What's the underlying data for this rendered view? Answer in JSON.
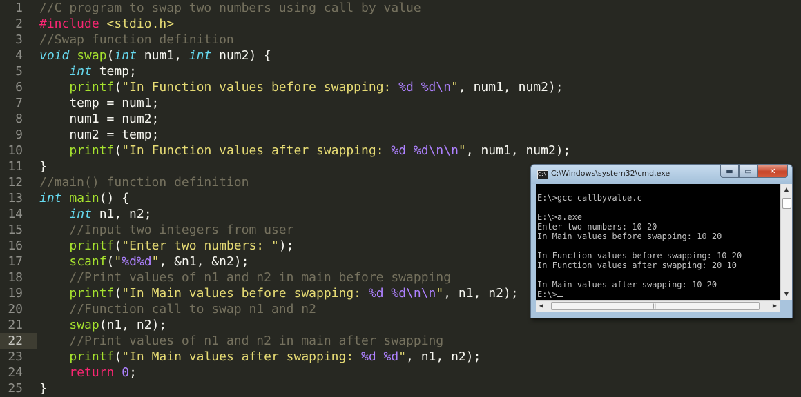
{
  "editor": {
    "active_line": 22,
    "lines": [
      {
        "n": "1",
        "tokens": [
          {
            "t": "//C program to swap two numbers using call by value",
            "c": "comment"
          }
        ]
      },
      {
        "n": "2",
        "tokens": [
          {
            "t": "#include",
            "c": "kw"
          },
          {
            "t": " ",
            "c": "plain"
          },
          {
            "t": "<stdio.h>",
            "c": "str"
          }
        ]
      },
      {
        "n": "3",
        "tokens": [
          {
            "t": "//Swap function definition",
            "c": "comment"
          }
        ]
      },
      {
        "n": "4",
        "tokens": [
          {
            "t": "void",
            "c": "type"
          },
          {
            "t": " ",
            "c": "plain"
          },
          {
            "t": "swap",
            "c": "fn"
          },
          {
            "t": "(",
            "c": "plain"
          },
          {
            "t": "int",
            "c": "type"
          },
          {
            "t": " num1, ",
            "c": "plain"
          },
          {
            "t": "int",
            "c": "type"
          },
          {
            "t": " num2) {",
            "c": "plain"
          }
        ]
      },
      {
        "n": "5",
        "tokens": [
          {
            "t": "    ",
            "c": "plain"
          },
          {
            "t": "int",
            "c": "type"
          },
          {
            "t": " temp;",
            "c": "plain"
          }
        ]
      },
      {
        "n": "6",
        "tokens": [
          {
            "t": "    ",
            "c": "plain"
          },
          {
            "t": "printf",
            "c": "fn"
          },
          {
            "t": "(",
            "c": "plain"
          },
          {
            "t": "\"In Function values before swapping: ",
            "c": "str"
          },
          {
            "t": "%d %d\\n",
            "c": "fmt"
          },
          {
            "t": "\"",
            "c": "str"
          },
          {
            "t": ", num1, num2);",
            "c": "plain"
          }
        ]
      },
      {
        "n": "7",
        "tokens": [
          {
            "t": "    temp = num1;",
            "c": "plain"
          }
        ]
      },
      {
        "n": "8",
        "tokens": [
          {
            "t": "    num1 = num2;",
            "c": "plain"
          }
        ]
      },
      {
        "n": "9",
        "tokens": [
          {
            "t": "    num2 = temp;",
            "c": "plain"
          }
        ]
      },
      {
        "n": "10",
        "tokens": [
          {
            "t": "    ",
            "c": "plain"
          },
          {
            "t": "printf",
            "c": "fn"
          },
          {
            "t": "(",
            "c": "plain"
          },
          {
            "t": "\"In Function values after swapping: ",
            "c": "str"
          },
          {
            "t": "%d %d\\n\\n",
            "c": "fmt"
          },
          {
            "t": "\"",
            "c": "str"
          },
          {
            "t": ", num1, num2);",
            "c": "plain"
          }
        ]
      },
      {
        "n": "11",
        "tokens": [
          {
            "t": "}",
            "c": "plain"
          }
        ]
      },
      {
        "n": "12",
        "tokens": [
          {
            "t": "//main() function definition",
            "c": "comment"
          }
        ]
      },
      {
        "n": "13",
        "tokens": [
          {
            "t": "int",
            "c": "type"
          },
          {
            "t": " ",
            "c": "plain"
          },
          {
            "t": "main",
            "c": "fn"
          },
          {
            "t": "() {",
            "c": "plain"
          }
        ]
      },
      {
        "n": "14",
        "tokens": [
          {
            "t": "    ",
            "c": "plain"
          },
          {
            "t": "int",
            "c": "type"
          },
          {
            "t": " n1, n2;",
            "c": "plain"
          }
        ]
      },
      {
        "n": "15",
        "tokens": [
          {
            "t": "    ",
            "c": "plain"
          },
          {
            "t": "//Input two integers from user",
            "c": "comment"
          }
        ]
      },
      {
        "n": "16",
        "tokens": [
          {
            "t": "    ",
            "c": "plain"
          },
          {
            "t": "printf",
            "c": "fn"
          },
          {
            "t": "(",
            "c": "plain"
          },
          {
            "t": "\"Enter two numbers: \"",
            "c": "str"
          },
          {
            "t": ");",
            "c": "plain"
          }
        ]
      },
      {
        "n": "17",
        "tokens": [
          {
            "t": "    ",
            "c": "plain"
          },
          {
            "t": "scanf",
            "c": "fn"
          },
          {
            "t": "(",
            "c": "plain"
          },
          {
            "t": "\"",
            "c": "str"
          },
          {
            "t": "%d%d",
            "c": "fmt"
          },
          {
            "t": "\"",
            "c": "str"
          },
          {
            "t": ", &n1, &n2);",
            "c": "plain"
          }
        ]
      },
      {
        "n": "18",
        "tokens": [
          {
            "t": "    ",
            "c": "plain"
          },
          {
            "t": "//Print values of n1 and n2 in main before swapping",
            "c": "comment"
          }
        ]
      },
      {
        "n": "19",
        "tokens": [
          {
            "t": "    ",
            "c": "plain"
          },
          {
            "t": "printf",
            "c": "fn"
          },
          {
            "t": "(",
            "c": "plain"
          },
          {
            "t": "\"In Main values before swapping: ",
            "c": "str"
          },
          {
            "t": "%d %d\\n\\n",
            "c": "fmt"
          },
          {
            "t": "\"",
            "c": "str"
          },
          {
            "t": ", n1, n2);",
            "c": "plain"
          }
        ]
      },
      {
        "n": "20",
        "tokens": [
          {
            "t": "    ",
            "c": "plain"
          },
          {
            "t": "//Function call to swap n1 and n2",
            "c": "comment"
          }
        ]
      },
      {
        "n": "21",
        "tokens": [
          {
            "t": "    ",
            "c": "plain"
          },
          {
            "t": "swap",
            "c": "fn"
          },
          {
            "t": "(n1, n2);",
            "c": "plain"
          }
        ]
      },
      {
        "n": "22",
        "tokens": [
          {
            "t": "    ",
            "c": "plain"
          },
          {
            "t": "//Print values of n1 and n2 in main after swapping",
            "c": "comment"
          }
        ]
      },
      {
        "n": "23",
        "tokens": [
          {
            "t": "    ",
            "c": "plain"
          },
          {
            "t": "printf",
            "c": "fn"
          },
          {
            "t": "(",
            "c": "plain"
          },
          {
            "t": "\"In Main values after swapping: ",
            "c": "str"
          },
          {
            "t": "%d %d",
            "c": "fmt"
          },
          {
            "t": "\"",
            "c": "str"
          },
          {
            "t": ", n1, n2);",
            "c": "plain"
          }
        ]
      },
      {
        "n": "24",
        "tokens": [
          {
            "t": "    ",
            "c": "plain"
          },
          {
            "t": "return",
            "c": "kw"
          },
          {
            "t": " ",
            "c": "plain"
          },
          {
            "t": "0",
            "c": "num"
          },
          {
            "t": ";",
            "c": "plain"
          }
        ]
      },
      {
        "n": "25",
        "tokens": [
          {
            "t": "}",
            "c": "plain"
          }
        ]
      }
    ]
  },
  "cmd": {
    "title": "C:\\Windows\\system32\\cmd.exe",
    "icon": "cmd-window-icon",
    "icon_text": "C:\\",
    "buttons": {
      "minimize": "▬",
      "maximize": "▭",
      "close": "✕"
    },
    "output": [
      "E:\\>gcc callbyvalue.c",
      "",
      "E:\\>a.exe",
      "Enter two numbers: 10 20",
      "In Main values before swapping: 10 20",
      "",
      "In Function values before swapping: 10 20",
      "In Function values after swapping: 20 10",
      "",
      "In Main values after swapping: 10 20"
    ],
    "prompt": "E:\\>",
    "scroll": {
      "up": "▲",
      "down": "▼",
      "left": "◀",
      "right": "▶",
      "grip": "|||"
    }
  },
  "colors": {
    "editor_bg": "#272822",
    "comment": "#75715e",
    "keyword": "#f92672",
    "type": "#66d9ef",
    "function": "#a6e22e",
    "string": "#e6db74",
    "format": "#ae81ff"
  }
}
